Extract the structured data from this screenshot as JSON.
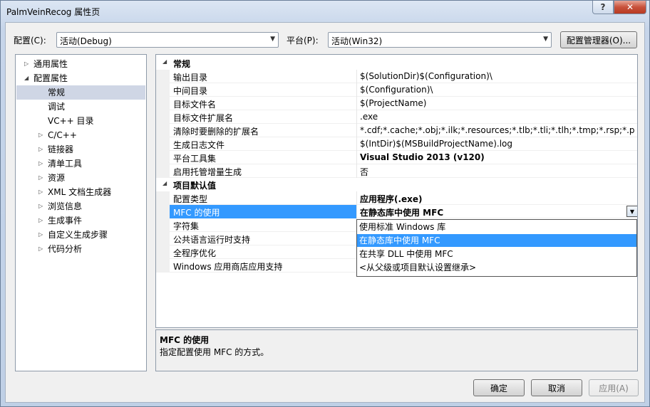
{
  "window": {
    "title": "PalmVeinRecog 属性页",
    "help": "?",
    "close": "✕"
  },
  "toolbar": {
    "config_label": "配置(C):",
    "config_value": "活动(Debug)",
    "platform_label": "平台(P):",
    "platform_value": "活动(Win32)",
    "manager_button": "配置管理器(O)..."
  },
  "tree": [
    {
      "label": "通用属性",
      "level": 0,
      "expander": "▷"
    },
    {
      "label": "配置属性",
      "level": 0,
      "expander": "◢"
    },
    {
      "label": "常规",
      "level": 1,
      "expander": "",
      "selected": true
    },
    {
      "label": "调试",
      "level": 1,
      "expander": ""
    },
    {
      "label": "VC++ 目录",
      "level": 1,
      "expander": ""
    },
    {
      "label": "C/C++",
      "level": 1,
      "expander": "▷"
    },
    {
      "label": "链接器",
      "level": 1,
      "expander": "▷"
    },
    {
      "label": "清单工具",
      "level": 1,
      "expander": "▷"
    },
    {
      "label": "资源",
      "level": 1,
      "expander": "▷"
    },
    {
      "label": "XML 文档生成器",
      "level": 1,
      "expander": "▷"
    },
    {
      "label": "浏览信息",
      "level": 1,
      "expander": "▷"
    },
    {
      "label": "生成事件",
      "level": 1,
      "expander": "▷"
    },
    {
      "label": "自定义生成步骤",
      "level": 1,
      "expander": "▷"
    },
    {
      "label": "代码分析",
      "level": 1,
      "expander": "▷"
    }
  ],
  "grid": {
    "general": {
      "header": "常规",
      "rows": [
        {
          "name": "输出目录",
          "value": "$(SolutionDir)$(Configuration)\\"
        },
        {
          "name": "中间目录",
          "value": "$(Configuration)\\"
        },
        {
          "name": "目标文件名",
          "value": "$(ProjectName)"
        },
        {
          "name": "目标文件扩展名",
          "value": ".exe"
        },
        {
          "name": "清除时要删除的扩展名",
          "value": "*.cdf;*.cache;*.obj;*.ilk;*.resources;*.tlb;*.tli;*.tlh;*.tmp;*.rsp;*.pgc;*.pg"
        },
        {
          "name": "生成日志文件",
          "value": "$(IntDir)$(MSBuildProjectName).log"
        },
        {
          "name": "平台工具集",
          "value": "Visual Studio 2013 (v120)",
          "bold": true
        },
        {
          "name": "启用托管增量生成",
          "value": "否"
        }
      ]
    },
    "defaults": {
      "header": "项目默认值",
      "rows": [
        {
          "name": "配置类型",
          "value": "应用程序(.exe)",
          "bold": true
        },
        {
          "name": "MFC 的使用",
          "value": "在静态库中使用 MFC",
          "bold": true,
          "selected": true
        },
        {
          "name": "字符集",
          "value": ""
        },
        {
          "name": "公共语言运行时支持",
          "value": ""
        },
        {
          "name": "全程序优化",
          "value": ""
        },
        {
          "name": "Windows 应用商店应用支持",
          "value": ""
        }
      ]
    }
  },
  "dropdown": {
    "options": [
      "使用标准 Windows 库",
      "在静态库中使用 MFC",
      "在共享 DLL 中使用 MFC",
      "<从父级或项目默认设置继承>"
    ],
    "highlighted": 1
  },
  "description": {
    "title": "MFC 的使用",
    "text": "指定配置使用 MFC 的方式。"
  },
  "buttons": {
    "ok": "确定",
    "cancel": "取消",
    "apply": "应用(A)"
  }
}
